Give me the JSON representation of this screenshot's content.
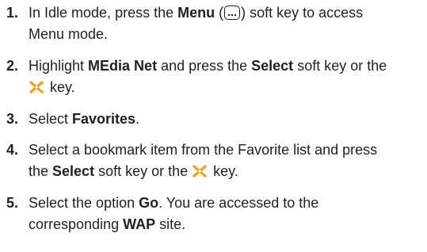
{
  "steps": [
    {
      "number": "1.",
      "line1_pre": "In Idle mode, press the ",
      "line1_bold": "Menu",
      "line1_open": " (",
      "line1_close": ") soft key to access",
      "line2": "Menu mode."
    },
    {
      "number": "2.",
      "pre": "Highlight ",
      "bold1": "MEdia Net",
      "mid": " and press the ",
      "bold2": "Select",
      "post": " soft key or the",
      "line2_post": " key."
    },
    {
      "number": "3.",
      "pre": "Select ",
      "bold": "Favorites",
      "post": "."
    },
    {
      "number": "4.",
      "line1": "Select a bookmark item from the Favorite list and press",
      "line2_pre": "the ",
      "line2_bold": "Select",
      "line2_mid": " soft key or the ",
      "line2_post": " key."
    },
    {
      "number": "5.",
      "line1_pre": "Select the option ",
      "line1_bold": "Go",
      "line1_post": ". You are accessed to the",
      "line2_pre": "corresponding ",
      "line2_bold": "WAP",
      "line2_post": " site."
    }
  ],
  "icons": {
    "menu_key": "menu-softkey-icon",
    "nav_key": "navigation-key-icon",
    "nav_key_color": "#f5a21b"
  }
}
